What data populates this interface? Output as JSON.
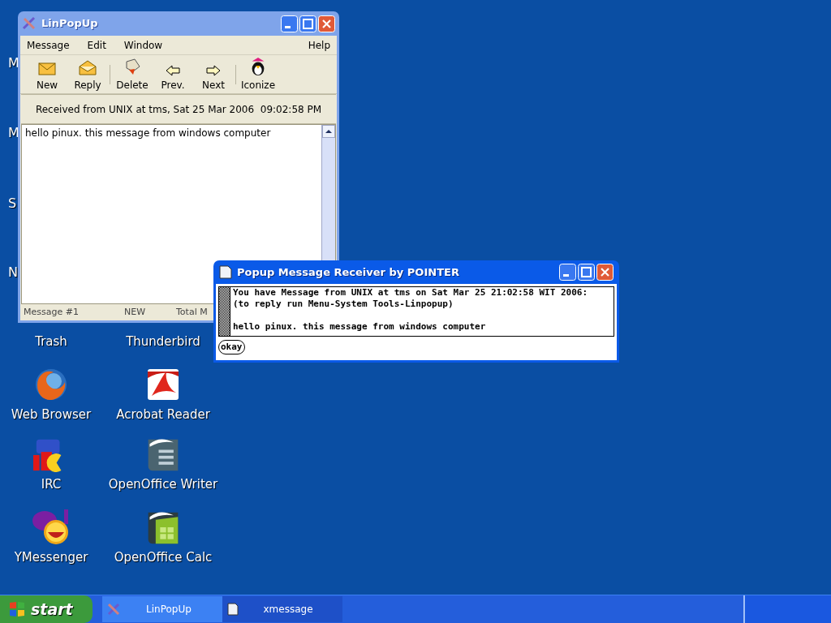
{
  "linpopup": {
    "title": "LinPopUp",
    "menu": [
      "Message",
      "Edit",
      "Window"
    ],
    "help_menu": "Help",
    "toolbar": [
      {
        "label": "New",
        "kind": "new"
      },
      {
        "label": "Reply",
        "kind": "reply"
      },
      {
        "label": "Delete",
        "kind": "delete"
      },
      {
        "label": "Prev.",
        "kind": "prev"
      },
      {
        "label": "Next",
        "kind": "next"
      },
      {
        "label": "Iconize",
        "kind": "iconize"
      }
    ],
    "header": "Received from UNIX at tms, Sat 25 Mar 2006  09:02:58 PM",
    "message": "hello pinux. this message from windows computer",
    "status_bar": [
      "Message #1",
      "NEW",
      "Total M"
    ]
  },
  "popup": {
    "title": "Popup Message Receiver by POINTER",
    "lines": [
      "You have Message from UNIX at tms on Sat Mar 25 21:02:58 WIT 2006:",
      "(to reply run Menu-System Tools-Linpopup)"
    ],
    "message": "hello pinux. this message from windows computer",
    "button": "okay"
  },
  "hidden_icon_labels": [
    "M",
    "M",
    "S",
    "N"
  ],
  "desktop_icons": [
    {
      "label": "Trash",
      "kind": "hidden"
    },
    {
      "label": "Thunderbird",
      "kind": "hidden"
    },
    {
      "label": "Web Browser",
      "kind": "browser"
    },
    {
      "label": "Acrobat Reader",
      "kind": "pdf"
    },
    {
      "label": "IRC",
      "kind": "irc"
    },
    {
      "label": "OpenOffice Writer",
      "kind": "writer"
    },
    {
      "label": "YMessenger",
      "kind": "messenger"
    },
    {
      "label": "OpenOffice Calc",
      "kind": "calc"
    }
  ],
  "taskbar": {
    "start": "start",
    "tasks": [
      {
        "label": "LinPopUp",
        "selected": true,
        "kind": "linpopup"
      },
      {
        "label": "xmessage",
        "selected": false,
        "kind": "xmessage"
      }
    ]
  }
}
